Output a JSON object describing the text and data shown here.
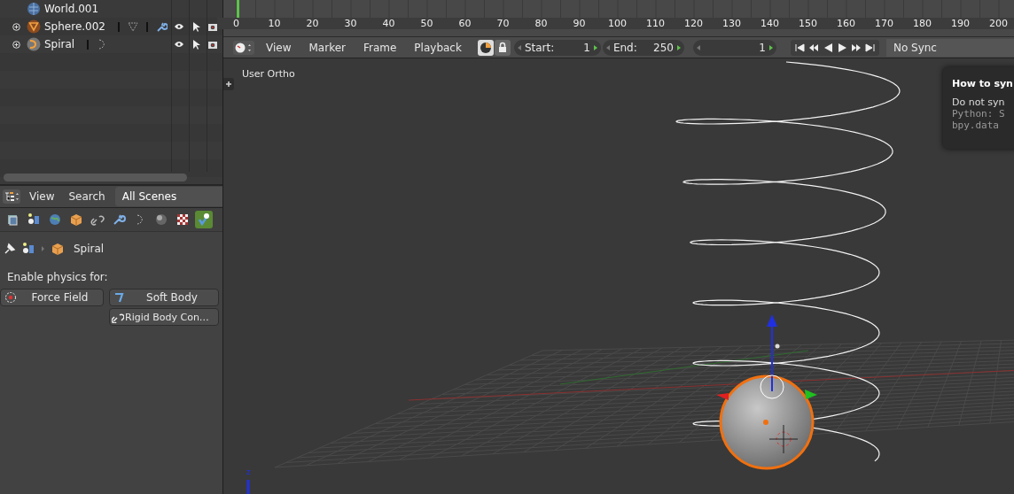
{
  "outliner": {
    "items": [
      {
        "name": "World.001",
        "kind": "world",
        "expandable": false
      },
      {
        "name": "Sphere.002",
        "kind": "mesh",
        "expandable": true
      },
      {
        "name": "Spiral",
        "kind": "curve",
        "expandable": true
      }
    ]
  },
  "properties": {
    "menus": [
      "View",
      "Search"
    ],
    "display_mode": "All Scenes",
    "context_tabs": [
      {
        "kind": "render-layers",
        "selected": false
      },
      {
        "kind": "scene",
        "selected": false
      },
      {
        "kind": "world",
        "selected": false
      },
      {
        "kind": "object",
        "selected": false
      },
      {
        "kind": "constraints",
        "selected": false
      },
      {
        "kind": "modifiers",
        "selected": false
      },
      {
        "kind": "curve",
        "selected": false
      },
      {
        "kind": "material",
        "selected": false
      },
      {
        "kind": "texture",
        "selected": false
      },
      {
        "kind": "physics",
        "selected": true
      }
    ],
    "breadcrumb": "Spiral",
    "section_label": "Enable physics for:",
    "buttons": [
      {
        "label": "Force Field",
        "kind": "force-field"
      },
      {
        "label": "Soft Body",
        "kind": "soft-body"
      },
      {
        "label": "Rigid Body Con…",
        "kind": "rigid-constraint"
      }
    ]
  },
  "timeline": {
    "ruler_labels": [
      "0",
      "10",
      "20",
      "30",
      "40",
      "50",
      "60",
      "70",
      "80",
      "90",
      "100",
      "110",
      "120",
      "130",
      "140",
      "150",
      "160",
      "170",
      "180",
      "190",
      "200"
    ],
    "menus": [
      "View",
      "Marker",
      "Frame",
      "Playback"
    ],
    "start": {
      "label": "Start:",
      "value": "1"
    },
    "end": {
      "label": "End:",
      "value": "250"
    },
    "current_frame": "1",
    "sync": "No Sync"
  },
  "viewport": {
    "view_label": "User Ortho",
    "axis_label": "z"
  },
  "tooltip": {
    "title": "How to syn",
    "description": "Do not syn",
    "python_lines": [
      "Python: S",
      "bpy.data"
    ]
  }
}
